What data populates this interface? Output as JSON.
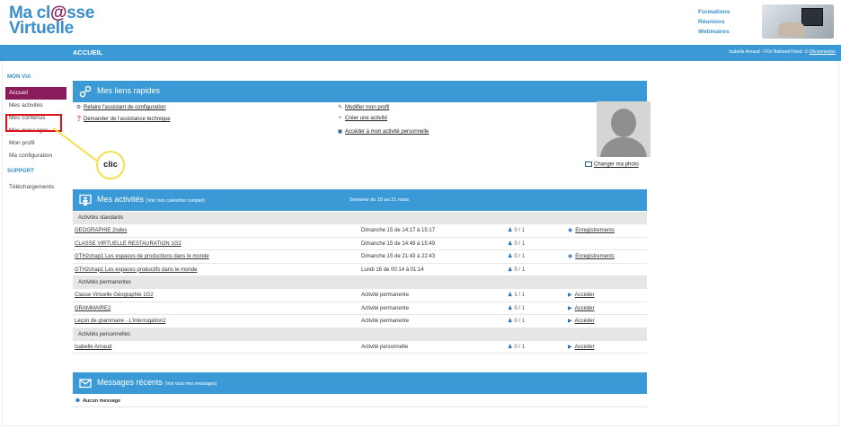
{
  "header": {
    "logo_line1_prefix": "Ma cl",
    "logo_line1_mark": "@",
    "logo_line1_suffix": "sse",
    "logo_line2": "Virtuelle",
    "promo": [
      "Formations",
      "Réunions",
      "Webinaires"
    ]
  },
  "topbar": {
    "title": "ACCUEIL",
    "user": "Isabelle Arnaud - FDx National Fixed",
    "logout": "Déconnexion"
  },
  "sidebar": {
    "section1": "MON VIA",
    "items": [
      {
        "label": "Accueil",
        "active": true
      },
      {
        "label": "Mes activités"
      },
      {
        "label": "Mes contenus"
      },
      {
        "label": "Mes messages"
      },
      {
        "label": "Mon profil"
      },
      {
        "label": "Ma configuration"
      }
    ],
    "section2": "SUPPORT",
    "support_items": [
      {
        "label": "Téléchargements"
      }
    ],
    "callout": "clic"
  },
  "quick_links": {
    "title": "Mes liens rapides",
    "left": [
      {
        "icon": "gear-icon",
        "label": "Refaire l'assistant de configuration"
      },
      {
        "icon": "help-icon",
        "label": "Demander de l'assistance technique"
      }
    ],
    "right": [
      {
        "icon": "pencil-icon",
        "label": "Modifier mon profil"
      },
      {
        "icon": "plus-icon",
        "label": "Créer une activité"
      },
      {
        "icon": "monitor-icon",
        "label": "Accéder à mon activité personnelle"
      }
    ],
    "photo_link": "Changer ma photo"
  },
  "activities": {
    "title": "Mes activités",
    "title_sub": "(Voir mon calendrier complet)",
    "week": "Semaine du 15 au 21 mars",
    "groups": [
      {
        "label": "Activités standards",
        "rows": [
          {
            "name": "GEOGRAPHIE 2ndes",
            "date": "Dimanche 15 de 14:17 à 15:17",
            "participants": "0 / 1",
            "action": "Enregistrements"
          },
          {
            "name": "CLASSE VIRTUELLE RESTAURATION 1G2",
            "date": "Dimanche 15 de 14:49 à 15:49",
            "participants": "0 / 1",
            "action": ""
          },
          {
            "name": "GTH2chap1 Les espaces de productions dans le monde",
            "date": "Dimanche 15 de 21:43 à 22:43",
            "participants": "0 / 1",
            "action": "Enregistrements"
          },
          {
            "name": "GTH2chap1 Les espaces productifs dans le monde",
            "date": "Lundi 16 de 00:14 à 01:14",
            "participants": "0 / 1",
            "action": ""
          }
        ]
      },
      {
        "label": "Activités permanentes",
        "rows": [
          {
            "name": "Classe Virtuelle Géographie 1G2",
            "date": "Activité permanente",
            "participants": "1 / 1",
            "action": "Accéder"
          },
          {
            "name": "GRAMMAIRE2",
            "date": "Activité permanente",
            "participants": "0 / 1",
            "action": "Accéder"
          },
          {
            "name": "Leçon de grammaire - L'interrogation2",
            "date": "Activité permanente",
            "participants": "0 / 1",
            "action": "Accéder"
          }
        ]
      },
      {
        "label": "Activités personnelles",
        "rows": [
          {
            "name": "Isabelle Arnaud",
            "date": "Activité personnelle",
            "participants": "0 / 1",
            "action": "Accéder"
          }
        ]
      }
    ]
  },
  "messages": {
    "title": "Messages récents",
    "title_sub": "(Voir tous mes messages)",
    "empty": "Aucun message"
  }
}
